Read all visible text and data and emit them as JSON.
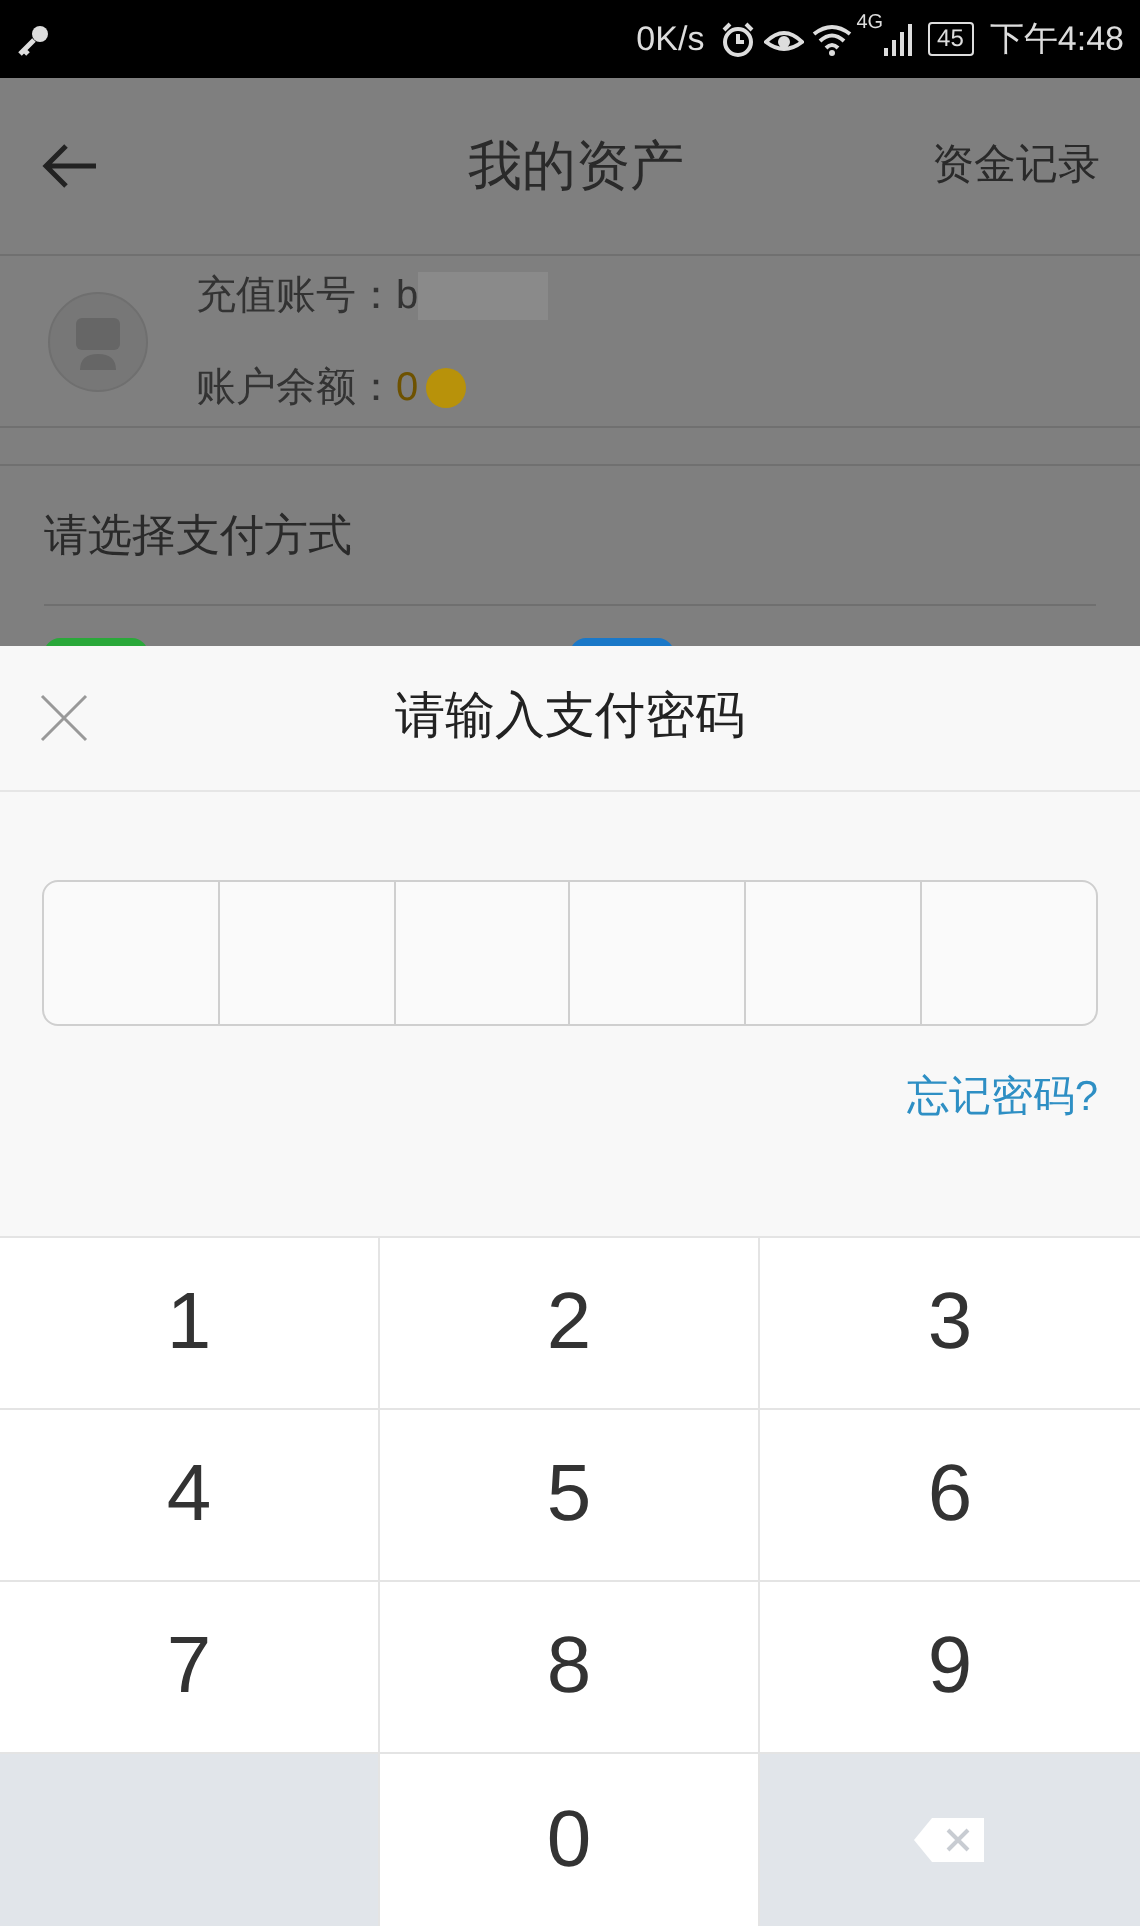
{
  "status_bar": {
    "speed": "0K/s",
    "network": "4G",
    "battery": "45",
    "time": "下午4:48"
  },
  "header": {
    "title": "我的资产",
    "action": "资金记录"
  },
  "account": {
    "account_label": "充值账号：",
    "account_value": "b",
    "balance_label": "账户余额：",
    "balance_value": "0"
  },
  "payment": {
    "title": "请选择支付方式",
    "methods": [
      {
        "color": "#2aa83a"
      },
      {
        "color": "#1a78c8"
      }
    ]
  },
  "sheet": {
    "title": "请输入支付密码",
    "pin_slots": [
      {
        "filled": false
      },
      {
        "filled": false
      },
      {
        "filled": false
      },
      {
        "filled": false
      },
      {
        "filled": false
      },
      {
        "filled": false
      }
    ],
    "forgot": "忘记密码?"
  },
  "keypad": [
    {
      "kind": "digit",
      "label": "1"
    },
    {
      "kind": "digit",
      "label": "2"
    },
    {
      "kind": "digit",
      "label": "3"
    },
    {
      "kind": "digit",
      "label": "4"
    },
    {
      "kind": "digit",
      "label": "5"
    },
    {
      "kind": "digit",
      "label": "6"
    },
    {
      "kind": "digit",
      "label": "7"
    },
    {
      "kind": "digit",
      "label": "8"
    },
    {
      "kind": "digit",
      "label": "9"
    },
    {
      "kind": "blank"
    },
    {
      "kind": "digit",
      "label": "0"
    },
    {
      "kind": "delete"
    }
  ]
}
